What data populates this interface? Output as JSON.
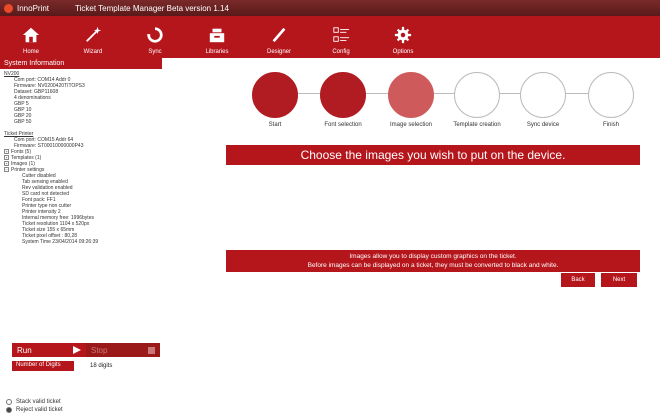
{
  "titlebar": {
    "app_name": "InnoPrint",
    "window_title": "Ticket Template Manager Beta version 1.14"
  },
  "toolbar": [
    {
      "label": "Home",
      "icon": "home-icon"
    },
    {
      "label": "Wizard",
      "icon": "wand-icon"
    },
    {
      "label": "Sync",
      "icon": "sync-icon"
    },
    {
      "label": "Libraries",
      "icon": "libraries-icon"
    },
    {
      "label": "Designer",
      "icon": "pen-icon"
    },
    {
      "label": "Config",
      "icon": "config-icon"
    },
    {
      "label": "Options",
      "icon": "gear-icon"
    }
  ],
  "sysinfo": {
    "header": "System Information",
    "nv": "NV200",
    "nv_lines": [
      "Com port: COM14 Addr 0",
      "Firmware: NV0200420TITOPS3",
      "Dataset: GBP11608",
      "4 denominations",
      "GBP 5",
      "GBP 10",
      "GBP 20",
      "GBP 50"
    ],
    "printer": "Ticket Printer",
    "printer_lines": [
      "Com port: COM15 Addr 64",
      "Firmware: ST00010000000P43"
    ],
    "nodes": [
      "Fonts (5)",
      "Templates (1)",
      "Images (1)",
      "Printer settings"
    ],
    "settings": [
      "Cutter disabled",
      "Tab sensing enabled",
      "Rev validation enabled",
      "SD card not detected",
      "Font pack: FF1",
      "Printer type non cutter",
      "Printer intensity 2",
      "Internal memory free: 1996bytes",
      "Ticket resolution 1104 x 520px",
      "Ticket size 155 x 65mm",
      "Ticket pixel offset : 80,28",
      "System Time 23/04/2014 09:26:39"
    ]
  },
  "run": {
    "run_label": "Run",
    "stop_label": "Stop"
  },
  "digits": {
    "label": "Number of Digits",
    "value": "18 digits"
  },
  "radios": [
    {
      "label": "Stack valid ticket",
      "checked": false
    },
    {
      "label": "Reject valid ticket",
      "checked": true
    }
  ],
  "steps": [
    {
      "label": "Start",
      "state": "done"
    },
    {
      "label": "Font selection",
      "state": "done"
    },
    {
      "label": "Image selection",
      "state": "current"
    },
    {
      "label": "Template creation",
      "state": "todo"
    },
    {
      "label": "Sync device",
      "state": "todo"
    },
    {
      "label": "Finish",
      "state": "todo"
    }
  ],
  "main": {
    "headline": "Choose the images you wish to put on the device.",
    "info_line1": "Images allow you to display custom graphics on the ticket.",
    "info_line2": "Before images can be displayed on a ticket, they must be converted to black and white.",
    "back": "Back",
    "next": "Next"
  },
  "colors": {
    "brand": "#b5161c",
    "current_step": "#cf5a5c"
  }
}
